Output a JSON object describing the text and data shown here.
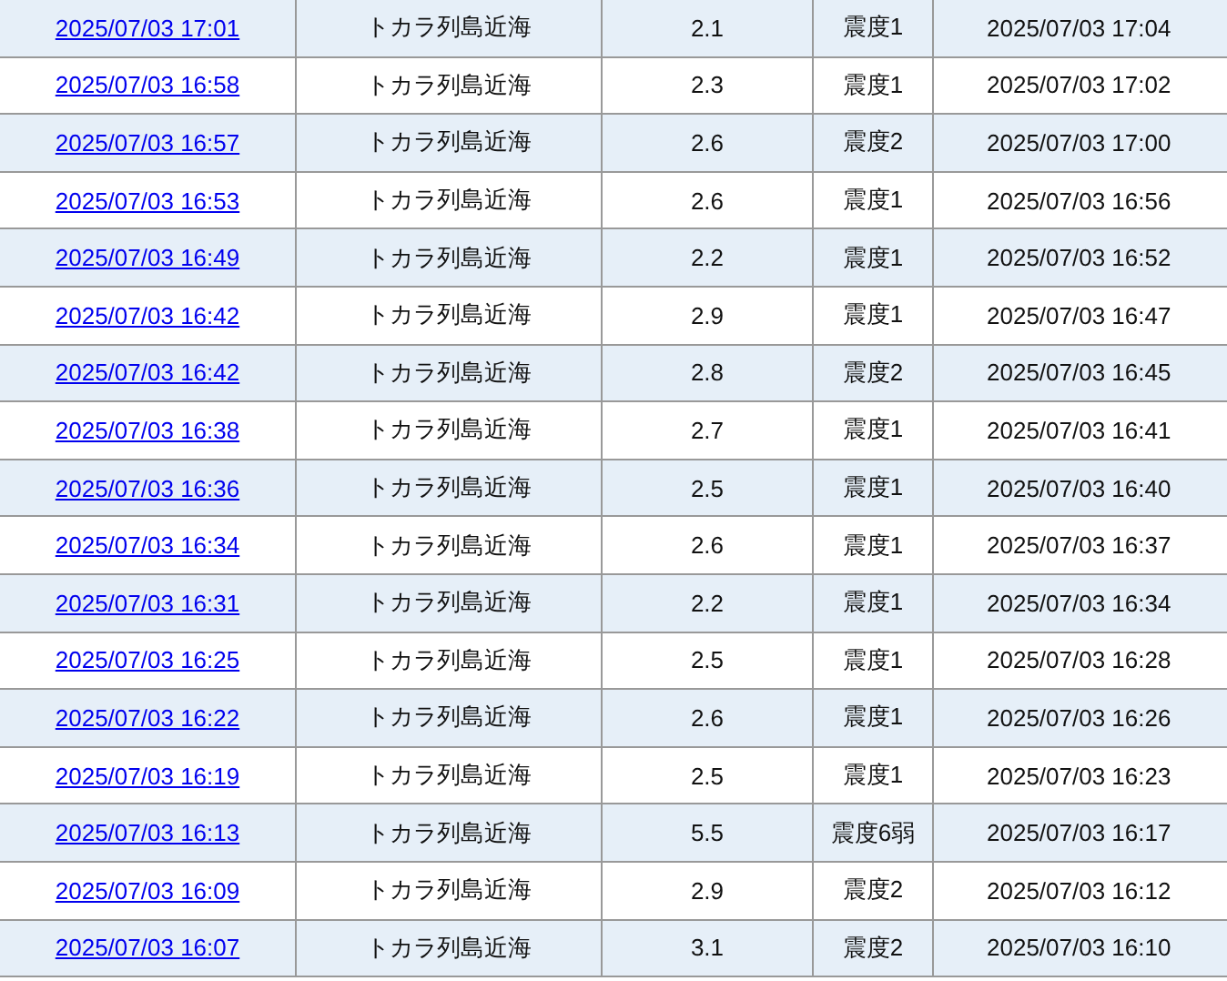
{
  "rows": [
    {
      "time": "2025/07/03 17:01",
      "region": "トカラ列島近海",
      "magnitude": "2.1",
      "intensity": "震度1",
      "announced": "2025/07/03 17:04"
    },
    {
      "time": "2025/07/03 16:58",
      "region": "トカラ列島近海",
      "magnitude": "2.3",
      "intensity": "震度1",
      "announced": "2025/07/03 17:02"
    },
    {
      "time": "2025/07/03 16:57",
      "region": "トカラ列島近海",
      "magnitude": "2.6",
      "intensity": "震度2",
      "announced": "2025/07/03 17:00"
    },
    {
      "time": "2025/07/03 16:53",
      "region": "トカラ列島近海",
      "magnitude": "2.6",
      "intensity": "震度1",
      "announced": "2025/07/03 16:56"
    },
    {
      "time": "2025/07/03 16:49",
      "region": "トカラ列島近海",
      "magnitude": "2.2",
      "intensity": "震度1",
      "announced": "2025/07/03 16:52"
    },
    {
      "time": "2025/07/03 16:42",
      "region": "トカラ列島近海",
      "magnitude": "2.9",
      "intensity": "震度1",
      "announced": "2025/07/03 16:47"
    },
    {
      "time": "2025/07/03 16:42",
      "region": "トカラ列島近海",
      "magnitude": "2.8",
      "intensity": "震度2",
      "announced": "2025/07/03 16:45"
    },
    {
      "time": "2025/07/03 16:38",
      "region": "トカラ列島近海",
      "magnitude": "2.7",
      "intensity": "震度1",
      "announced": "2025/07/03 16:41"
    },
    {
      "time": "2025/07/03 16:36",
      "region": "トカラ列島近海",
      "magnitude": "2.5",
      "intensity": "震度1",
      "announced": "2025/07/03 16:40"
    },
    {
      "time": "2025/07/03 16:34",
      "region": "トカラ列島近海",
      "magnitude": "2.6",
      "intensity": "震度1",
      "announced": "2025/07/03 16:37"
    },
    {
      "time": "2025/07/03 16:31",
      "region": "トカラ列島近海",
      "magnitude": "2.2",
      "intensity": "震度1",
      "announced": "2025/07/03 16:34"
    },
    {
      "time": "2025/07/03 16:25",
      "region": "トカラ列島近海",
      "magnitude": "2.5",
      "intensity": "震度1",
      "announced": "2025/07/03 16:28"
    },
    {
      "time": "2025/07/03 16:22",
      "region": "トカラ列島近海",
      "magnitude": "2.6",
      "intensity": "震度1",
      "announced": "2025/07/03 16:26"
    },
    {
      "time": "2025/07/03 16:19",
      "region": "トカラ列島近海",
      "magnitude": "2.5",
      "intensity": "震度1",
      "announced": "2025/07/03 16:23"
    },
    {
      "time": "2025/07/03 16:13",
      "region": "トカラ列島近海",
      "magnitude": "5.5",
      "intensity": "震度6弱",
      "announced": "2025/07/03 16:17"
    },
    {
      "time": "2025/07/03 16:09",
      "region": "トカラ列島近海",
      "magnitude": "2.9",
      "intensity": "震度2",
      "announced": "2025/07/03 16:12"
    },
    {
      "time": "2025/07/03 16:07",
      "region": "トカラ列島近海",
      "magnitude": "3.1",
      "intensity": "震度2",
      "announced": "2025/07/03 16:10"
    }
  ]
}
